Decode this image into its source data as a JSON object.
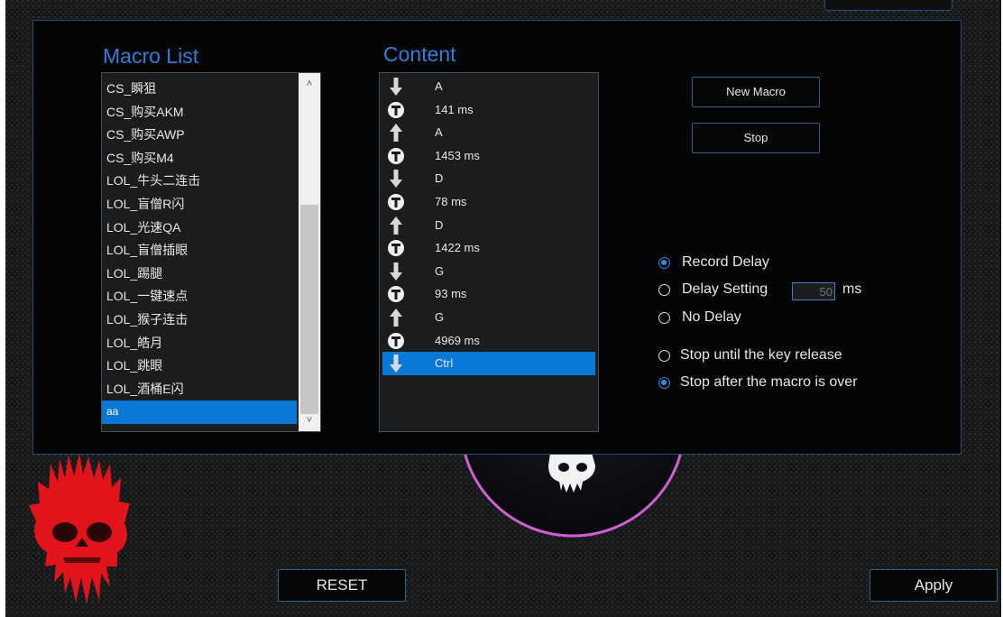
{
  "macro_list": {
    "title": "Macro List",
    "items": [
      "CS_瞬狙",
      "CS_购买AKM",
      "CS_购买AWP",
      "CS_购买M4",
      "LOL_牛头二连击",
      "LOL_盲僧R闪",
      "LOL_光速QA",
      "LOL_盲僧插眼",
      "LOL_踢腿",
      "LOL_一键速点",
      "LOL_猴子连击",
      "LOL_皓月",
      "LOL_跳眼",
      "LOL_酒桶E闪",
      "aa"
    ],
    "selected_index": 14
  },
  "content": {
    "title": "Content",
    "rows": [
      {
        "icon": "arrow-down-icon",
        "text": "A"
      },
      {
        "icon": "timer-icon",
        "text": "141 ms"
      },
      {
        "icon": "arrow-up-icon",
        "text": "A"
      },
      {
        "icon": "timer-icon",
        "text": "1453 ms"
      },
      {
        "icon": "arrow-down-icon",
        "text": "D"
      },
      {
        "icon": "timer-icon",
        "text": "78 ms"
      },
      {
        "icon": "arrow-up-icon",
        "text": "D"
      },
      {
        "icon": "timer-icon",
        "text": "1422 ms"
      },
      {
        "icon": "arrow-down-icon",
        "text": "G"
      },
      {
        "icon": "timer-icon",
        "text": "93 ms"
      },
      {
        "icon": "arrow-up-icon",
        "text": "G"
      },
      {
        "icon": "timer-icon",
        "text": "4969 ms"
      },
      {
        "icon": "arrow-down-icon",
        "text": "Ctrl"
      }
    ],
    "selected_index": 12
  },
  "buttons": {
    "new_macro": "New Macro",
    "stop": "Stop",
    "reset": "RESET",
    "apply": "Apply"
  },
  "delay_options": {
    "record_delay": "Record Delay",
    "delay_setting": "Delay Setting",
    "no_delay": "No Delay",
    "selected": "record_delay",
    "delay_value": "50",
    "unit": "ms"
  },
  "stop_options": {
    "until_release": "Stop until the key release",
    "after_macro": "Stop after the macro is over",
    "selected": "after_macro"
  },
  "colors": {
    "accent": "#0a78d7",
    "title_blue": "#2f7fd4",
    "skull_red": "#e0141a",
    "ring_pink": "#d05fd0"
  }
}
